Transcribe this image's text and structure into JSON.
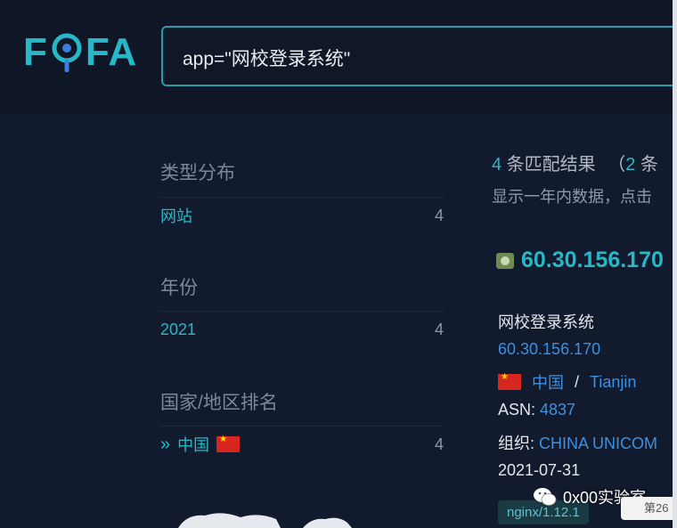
{
  "logo": {
    "left": "F",
    "right": "FA"
  },
  "search": {
    "value": "app=\"网校登录系统\""
  },
  "sidebar": {
    "sections": [
      {
        "title": "类型分布",
        "label": "网站",
        "count": "4"
      },
      {
        "title": "年份",
        "label": "2021",
        "count": "4"
      },
      {
        "title": "国家/地区排名",
        "label": "中国",
        "count": "4"
      }
    ]
  },
  "summary": {
    "count": "4",
    "text": " 条匹配结果",
    "extra_open": "（",
    "extra_count": "2",
    "extra_text": " 条",
    "note": "显示一年内数据，点击"
  },
  "result": {
    "ip_title": "60.30.156.170",
    "site_title": "网校登录系统",
    "ip_link": "60.30.156.170",
    "country": "中国",
    "sep": "/",
    "city": "Tianjin",
    "asn_label": "ASN: ",
    "asn": "4837",
    "org_label": "组织: ",
    "org": "CHINA UNICOM",
    "date": "2021-07-31",
    "tag": "nginx/1.12.1"
  },
  "watermark": {
    "text": "0x00实验室",
    "page": "第26"
  },
  "colors": {
    "accent": "#27b7c6",
    "link": "#3e8fe0",
    "bg": "#121b2e"
  }
}
